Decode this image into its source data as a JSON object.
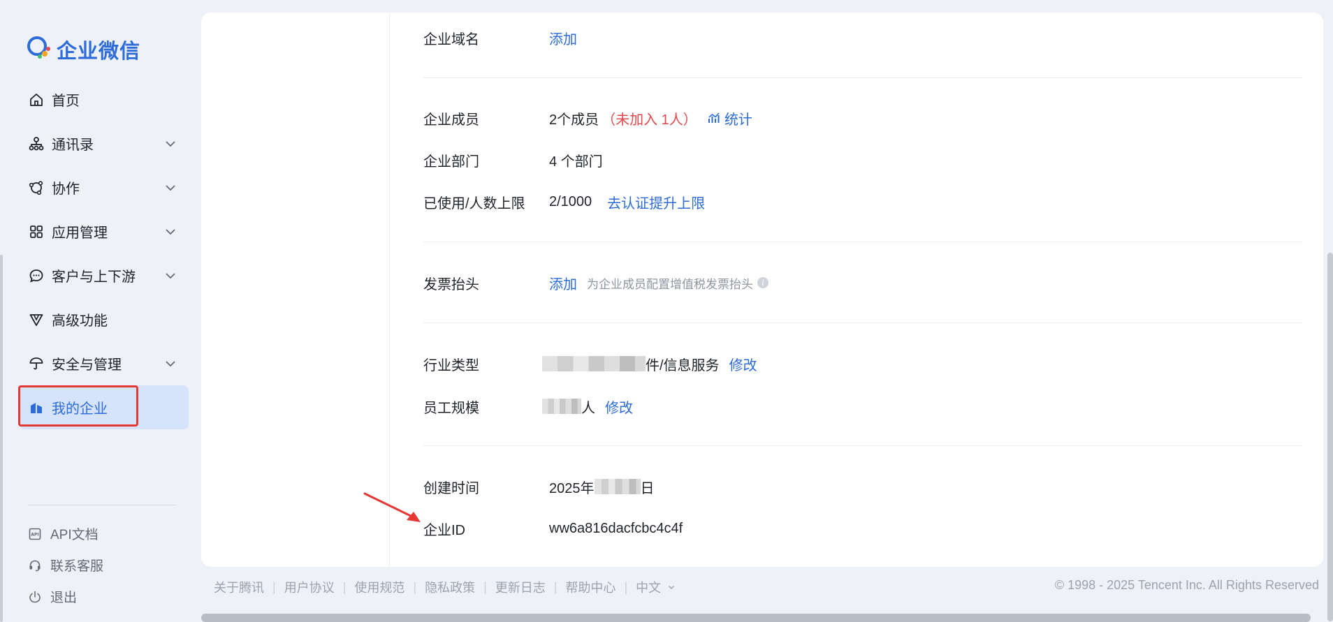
{
  "app": {
    "logo_text": "企业微信",
    "accent_color": "#2c6bd8"
  },
  "sidebar": {
    "items": [
      {
        "label": "首页",
        "icon": "home-icon",
        "expandable": false
      },
      {
        "label": "通讯录",
        "icon": "org-chart-icon",
        "expandable": true
      },
      {
        "label": "协作",
        "icon": "collaboration-icon",
        "expandable": true
      },
      {
        "label": "应用管理",
        "icon": "apps-grid-icon",
        "expandable": true
      },
      {
        "label": "客户与上下游",
        "icon": "chat-bubble-icon",
        "expandable": true
      },
      {
        "label": "高级功能",
        "icon": "advanced-v-icon",
        "expandable": false
      },
      {
        "label": "安全与管理",
        "icon": "umbrella-icon",
        "expandable": true
      },
      {
        "label": "我的企业",
        "icon": "company-icon",
        "expandable": false,
        "active": true
      }
    ],
    "bottom": [
      {
        "label": "API文档",
        "icon": "api-doc-icon"
      },
      {
        "label": "联系客服",
        "icon": "headset-icon"
      },
      {
        "label": "退出",
        "icon": "power-icon"
      }
    ]
  },
  "company": {
    "domain": {
      "label": "企业域名",
      "action": "添加"
    },
    "members": {
      "label": "企业成员",
      "value": "2个成员",
      "not_joined": "（未加入 1人）",
      "stats_link": "统计"
    },
    "departments": {
      "label": "企业部门",
      "value": "4 个部门"
    },
    "usage": {
      "label": "已使用/人数上限",
      "value": "2/1000",
      "link": "去认证提升上限"
    },
    "invoice": {
      "label": "发票抬头",
      "action": "添加",
      "hint": "为企业成员配置增值税发票抬头"
    },
    "industry": {
      "label": "行业类型",
      "value_suffix": "件/信息服务",
      "action": "修改"
    },
    "scale": {
      "label": "员工规模",
      "value_suffix": "人",
      "action": "修改"
    },
    "created": {
      "label": "创建时间",
      "value_prefix": "2025年",
      "value_suffix": "日"
    },
    "corp_id": {
      "label": "企业ID",
      "value": "ww6a816dacfcbc4c4f"
    }
  },
  "footer": {
    "links": [
      "关于腾讯",
      "用户协议",
      "使用规范",
      "隐私政策",
      "更新日志",
      "帮助中心"
    ],
    "language": "中文",
    "copyright": "© 1998 - 2025 Tencent Inc. All Rights Reserved"
  }
}
